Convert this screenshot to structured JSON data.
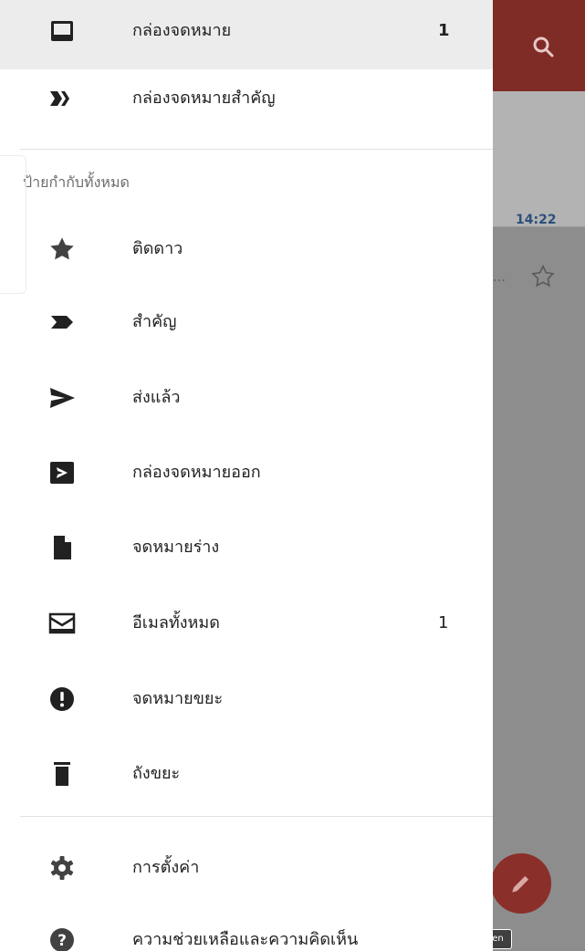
{
  "background": {
    "email_time": "14:22",
    "email_snippet_ellipsis": "…",
    "watermark": "Powered by Mobizen"
  },
  "drawer": {
    "top_items": [
      {
        "label": "กล่องจดหมาย",
        "count": "1",
        "icon": "inbox-icon",
        "selected": true
      },
      {
        "label": "กล่องจดหมายสำคัญ",
        "count": "",
        "icon": "priority-inbox-icon"
      }
    ],
    "labels_header": "ป้ายกำกับทั้งหมด",
    "label_items": [
      {
        "label": "ติดดาว",
        "count": "",
        "icon": "star-icon"
      },
      {
        "label": "สำคัญ",
        "count": "",
        "icon": "important-icon"
      },
      {
        "label": "ส่งแล้ว",
        "count": "",
        "icon": "send-icon"
      },
      {
        "label": "กล่องจดหมายออก",
        "count": "",
        "icon": "outbox-icon"
      },
      {
        "label": "จดหมายร่าง",
        "count": "",
        "icon": "draft-icon"
      },
      {
        "label": "อีเมลทั้งหมด",
        "count": "1",
        "icon": "all-mail-icon"
      },
      {
        "label": "จดหมายขยะ",
        "count": "",
        "icon": "spam-icon"
      },
      {
        "label": "ถังขยะ",
        "count": "",
        "icon": "trash-icon"
      }
    ],
    "bottom_items": [
      {
        "label": "การตั้งค่า",
        "icon": "settings-gear-icon"
      },
      {
        "label": "ความช่วยเหลือและความคิดเห็น",
        "icon": "help-icon"
      }
    ]
  }
}
